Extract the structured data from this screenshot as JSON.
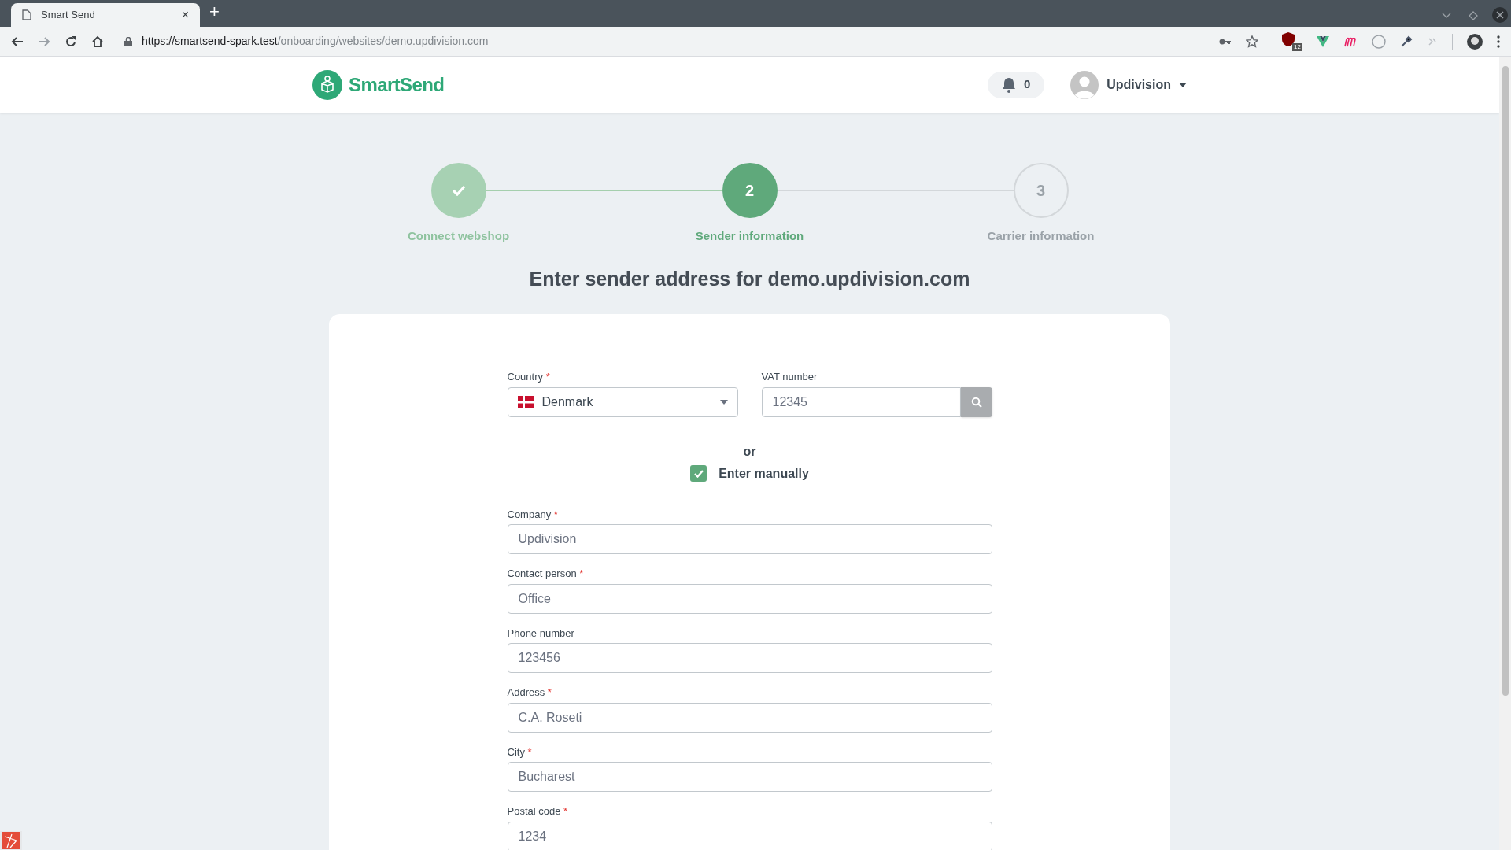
{
  "browser": {
    "tab_title": "Smart Send",
    "tab_close": "×",
    "new_tab": "+",
    "url_host": "https://smartsend-spark.test",
    "url_path": "/onboarding/websites/demo.updivision.com",
    "extension_badge": "12"
  },
  "header": {
    "logo": "SmartSend",
    "notifications": "0",
    "user": "Updivision"
  },
  "steps": [
    {
      "label": "Connect webshop",
      "completed": true,
      "selected": false
    },
    {
      "label": "Sender information",
      "number": "2",
      "completed": false,
      "selected": true
    },
    {
      "label": "Carrier information",
      "number": "3",
      "completed": false,
      "selected": false
    }
  ],
  "heading": "Enter sender address for demo.updivision.com",
  "lookup": {
    "country": {
      "label": "Country",
      "required_mark": "*",
      "value": "Denmark"
    },
    "vat": {
      "label": "VAT number",
      "value": "12345"
    }
  },
  "or": "or",
  "enter_manually": {
    "label": "Enter manually",
    "checked": true
  },
  "fields": [
    {
      "label": "Company",
      "required_mark": "*",
      "value": "Updivision"
    },
    {
      "label": "Contact person",
      "required_mark": "*",
      "value": "Office"
    },
    {
      "label": "Phone number",
      "value": "123456"
    },
    {
      "label": "Address",
      "required_mark": "*",
      "value": "C.A. Roseti"
    },
    {
      "label": "City",
      "required_mark": "*",
      "value": "Bucharest"
    },
    {
      "label": "Postal code",
      "required_mark": "*",
      "value": "1234"
    }
  ]
}
